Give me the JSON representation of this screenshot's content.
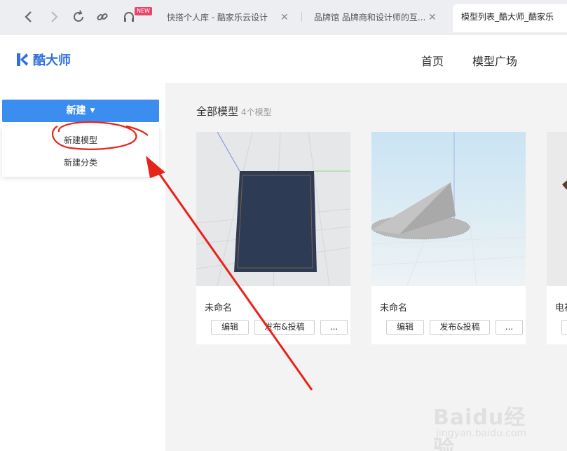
{
  "browser": {
    "new_badge": "NEW",
    "tabs": [
      {
        "title": "快搭个人库 - 酷家乐云设计"
      },
      {
        "title": "品牌馆 品牌商和设计师的互..."
      }
    ],
    "active_tab": "模型列表_酷大师_酷家乐"
  },
  "header": {
    "logo_text": "酷大师",
    "nav": [
      "首页",
      "模型广场"
    ]
  },
  "sidebar": {
    "new_button": "新建",
    "dropdown": [
      "新建模型",
      "新建分类"
    ]
  },
  "main": {
    "section_title": "全部模型",
    "section_count": "4个模型",
    "cards": [
      {
        "name": "未命名",
        "buttons": [
          "编辑",
          "发布&投稿",
          "..."
        ]
      },
      {
        "name": "未命名",
        "buttons": [
          "编辑",
          "发布&投稿",
          "..."
        ]
      }
    ],
    "partial_card_name": "电视"
  },
  "watermark": {
    "brand": "Baidu经验",
    "url": "jingyan.baidu.com"
  },
  "colors": {
    "accent": "#3b8df0",
    "logo": "#2f6fe0",
    "annotation": "#e8231a"
  }
}
